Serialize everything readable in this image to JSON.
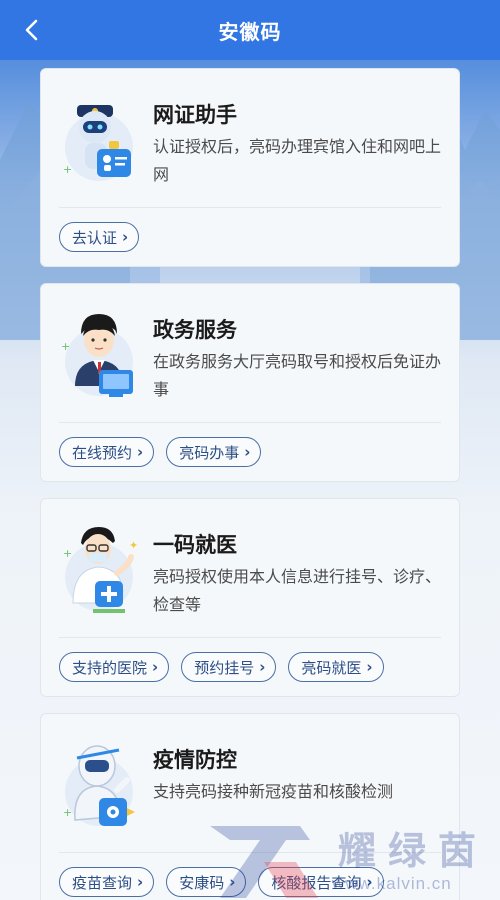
{
  "header": {
    "title": "安徽码"
  },
  "cards": [
    {
      "title": "网证助手",
      "desc": "认证授权后，亮码办理宾馆入住和网吧上网",
      "buttons": [
        {
          "label": "去认证"
        }
      ]
    },
    {
      "title": "政务服务",
      "desc": "在政务服务大厅亮码取号和授权后免证办事",
      "buttons": [
        {
          "label": "在线预约"
        },
        {
          "label": "亮码办事"
        }
      ]
    },
    {
      "title": "一码就医",
      "desc": "亮码授权使用本人信息进行挂号、诊疗、检查等",
      "buttons": [
        {
          "label": "支持的医院"
        },
        {
          "label": "预约挂号"
        },
        {
          "label": "亮码就医"
        }
      ]
    },
    {
      "title": "疫情防控",
      "desc": "支持亮码接种新冠疫苗和核酸检测",
      "buttons": [
        {
          "label": "疫苗查询"
        },
        {
          "label": "安康码"
        },
        {
          "label": "核酸报告查询"
        }
      ]
    }
  ],
  "watermark": {
    "brand": "耀绿茵",
    "url": "www.kalvin.cn"
  },
  "colors": {
    "header": "#3276e3",
    "pill_border": "#4a6fa5",
    "pill_text": "#2d4f86",
    "card_bg": "#f5f8fb"
  },
  "icons": {
    "back": "chevron-left-icon",
    "pill": "chevron-right-icon"
  }
}
